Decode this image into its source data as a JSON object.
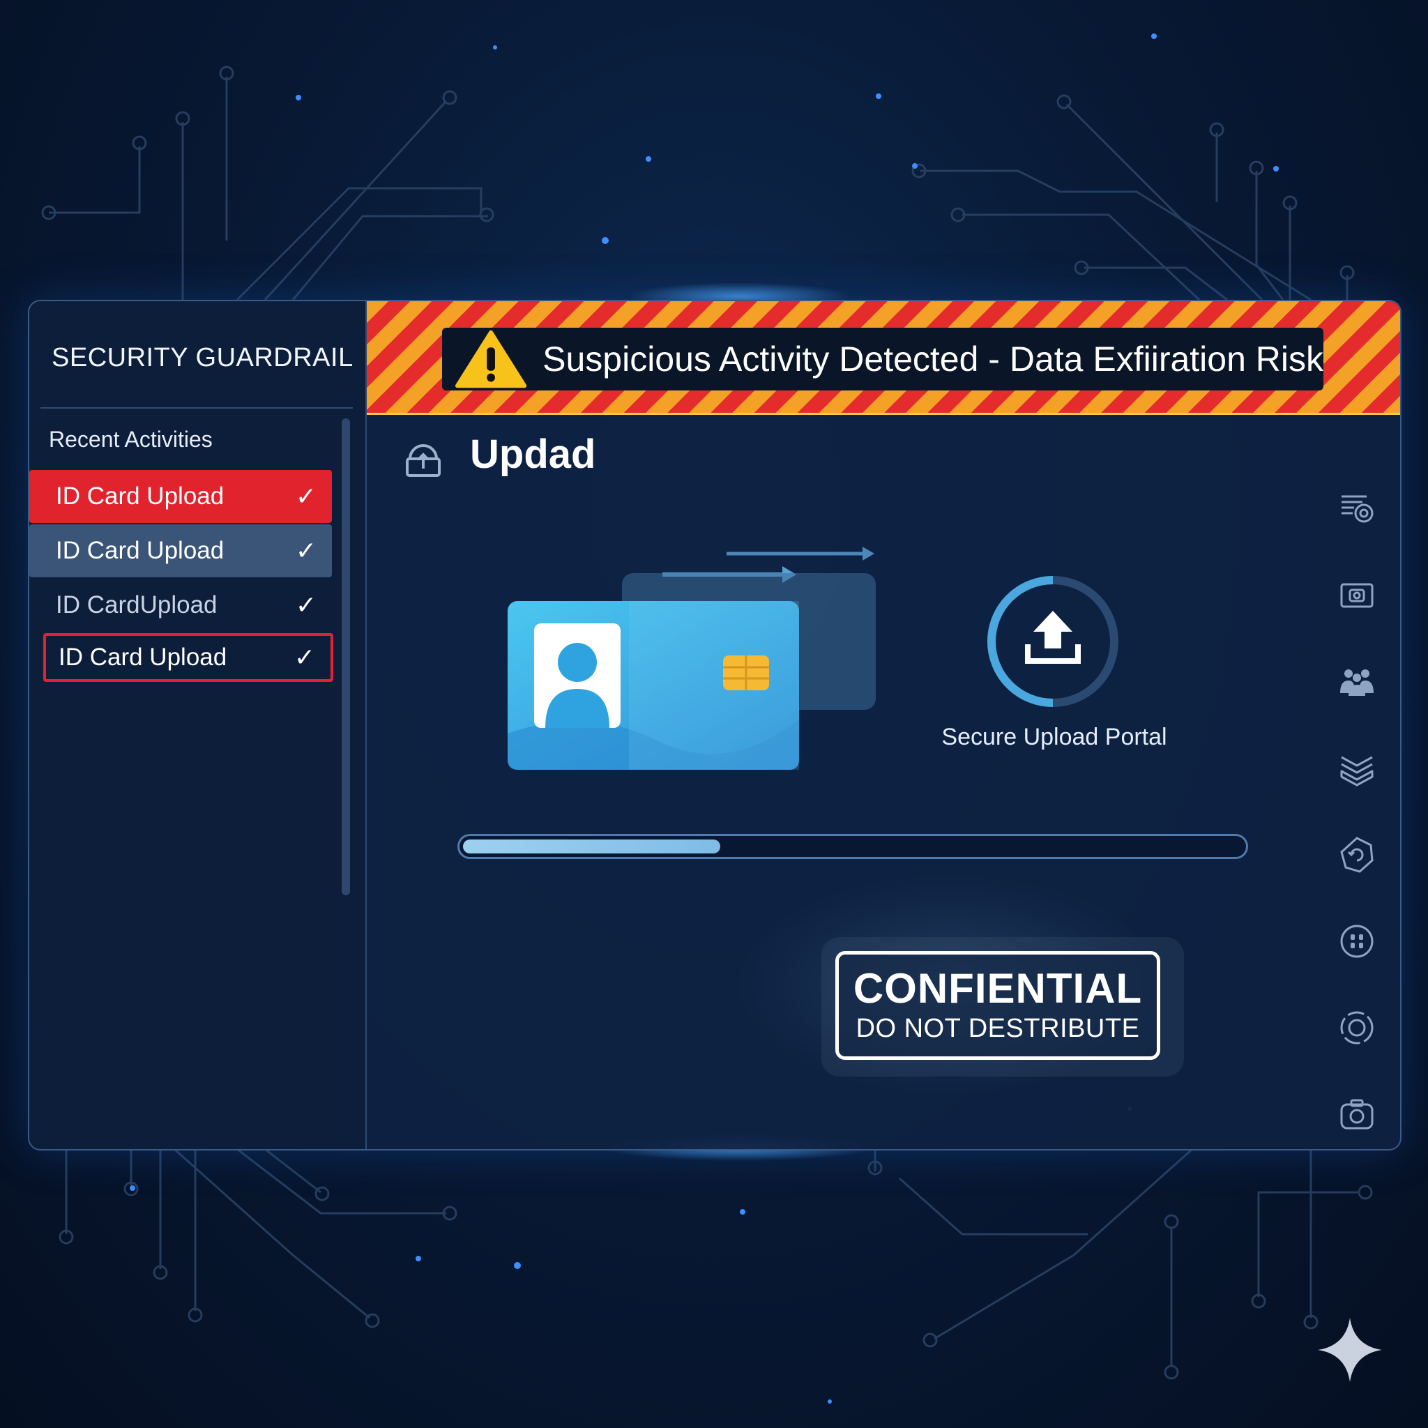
{
  "app": {
    "title": "SECURITY GUARDRAIL"
  },
  "sidebar": {
    "section_label": "Recent Activities",
    "items": [
      {
        "label": "ID Card Upload",
        "state": "alert",
        "icon": "check-icon"
      },
      {
        "label": "ID Card Upload",
        "state": "selected",
        "icon": "check-icon"
      },
      {
        "label": "ID CardUpload",
        "state": "dimmed",
        "icon": "check-icon"
      },
      {
        "label": "ID Card Upload",
        "state": "outlined-alert",
        "icon": "check-icon"
      }
    ]
  },
  "banner": {
    "text": "Suspicious Activity Detected - Data Exfiiration Risk",
    "icon": "warning-triangle-icon",
    "colors": {
      "stripe_a": "#f4a227",
      "stripe_b": "#e42c2c"
    }
  },
  "main": {
    "title": "Updad",
    "title_icon": "upload-cloud-icon",
    "portal_label": "Secure Upload Portal",
    "portal_icon": "upload-tray-icon",
    "progress": 0.33
  },
  "stamp": {
    "title": "CONFIENTIAL",
    "subtitle": "DO NOT DESTRIBUTE"
  },
  "right_rail": {
    "icons": [
      "list-settings-icon",
      "camera-frame-icon",
      "users-group-icon",
      "layers-shield-icon",
      "refresh-badge-icon",
      "face-scan-icon",
      "target-icon",
      "camera-icon"
    ]
  },
  "colors": {
    "alert_red": "#e1232e",
    "selected_bg": "#3a5578",
    "accent_blue": "#4aa8df",
    "background": "#06132a"
  }
}
